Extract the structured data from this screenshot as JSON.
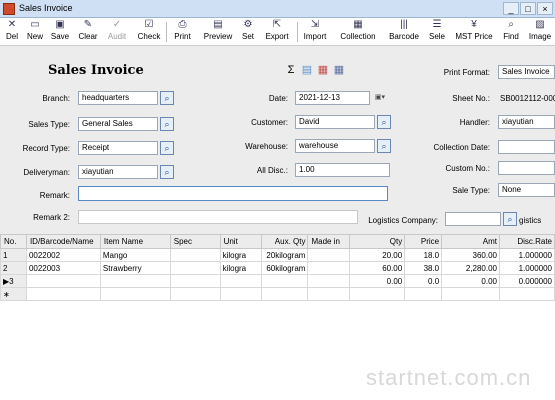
{
  "window": {
    "title": "Sales Invoice"
  },
  "toolbar": {
    "buttons": [
      {
        "label": "Del",
        "icon": "delete-icon"
      },
      {
        "label": "New",
        "icon": "new-icon"
      },
      {
        "label": "Save",
        "icon": "save-icon"
      },
      {
        "label": "Clear",
        "icon": "clear-icon"
      },
      {
        "label": "Audit",
        "icon": "audit-icon"
      },
      {
        "label": "Check",
        "icon": "check-icon"
      },
      {
        "label": "Print",
        "icon": "print-icon"
      },
      {
        "label": "Preview",
        "icon": "preview-icon"
      },
      {
        "label": "Set",
        "icon": "set-icon"
      },
      {
        "label": "Export",
        "icon": "export-icon"
      },
      {
        "label": "Import",
        "icon": "import-icon"
      },
      {
        "label": "Collection",
        "icon": "collection-icon"
      },
      {
        "label": "Barcode",
        "icon": "barcode-icon"
      },
      {
        "label": "Sele",
        "icon": "select-icon"
      },
      {
        "label": "MST Price",
        "icon": "price-icon"
      },
      {
        "label": "Find",
        "icon": "find-icon"
      },
      {
        "label": "Image",
        "icon": "image-icon"
      }
    ]
  },
  "form": {
    "title": "Sales Invoice",
    "branch": {
      "label": "Branch:",
      "value": "headquarters"
    },
    "sales_type": {
      "label": "Sales Type:",
      "value": "General Sales"
    },
    "record_type": {
      "label": "Record Type:",
      "value": "Receipt"
    },
    "deliveryman": {
      "label": "Deliveryman:",
      "value": "xiayutian"
    },
    "date": {
      "label": "Date:",
      "value": "2021-12-13"
    },
    "customer": {
      "label": "Customer:",
      "value": "David"
    },
    "warehouse": {
      "label": "Warehouse:",
      "value": "warehouse"
    },
    "all_disc": {
      "label": "All Disc.:",
      "value": "1.00"
    },
    "remark": {
      "label": "Remark:",
      "value": ""
    },
    "remark2": {
      "label": "Remark 2:",
      "value": ""
    },
    "print_format": {
      "label": "Print Format:",
      "value": "Sales Invoice"
    },
    "sheet_no": {
      "label": "Sheet No.:",
      "value": "SB0012112-000"
    },
    "handler": {
      "label": "Handler:",
      "value": "xiayutian"
    },
    "collection_date": {
      "label": "Collection Date:",
      "value": ""
    },
    "custom_no": {
      "label": "Custom No.:",
      "value": ""
    },
    "sale_type": {
      "label": "Sale Type:",
      "value": "None"
    },
    "logistics_company": {
      "label": "Logistics Company:",
      "value": ""
    },
    "logistics_partial": "gistics"
  },
  "grid": {
    "columns": [
      "No.",
      "ID/Barcode/Name",
      "Item Name",
      "Spec",
      "Unit",
      "Aux. Qty",
      "Made in",
      "Qty",
      "Price",
      "Amt",
      "Disc.Rate"
    ],
    "rows": [
      [
        "1",
        "0022002",
        "Mango",
        "",
        "kilogra",
        "20kilogram",
        "",
        "20.00",
        "18.0",
        "360.00",
        "1.000000"
      ],
      [
        "2",
        "0022003",
        "Strawberry",
        "",
        "kilogra",
        "60kilogram",
        "",
        "60.00",
        "38.0",
        "2,280.00",
        "1.000000"
      ],
      [
        "▶3",
        "",
        "",
        "",
        "",
        "",
        "",
        "0.00",
        "0.0",
        "0.00",
        "0.000000"
      ],
      [
        "∗",
        "",
        "",
        "",
        "",
        "",
        "",
        "",
        "",
        "",
        ""
      ]
    ]
  },
  "watermark": "startnet.com.cn"
}
